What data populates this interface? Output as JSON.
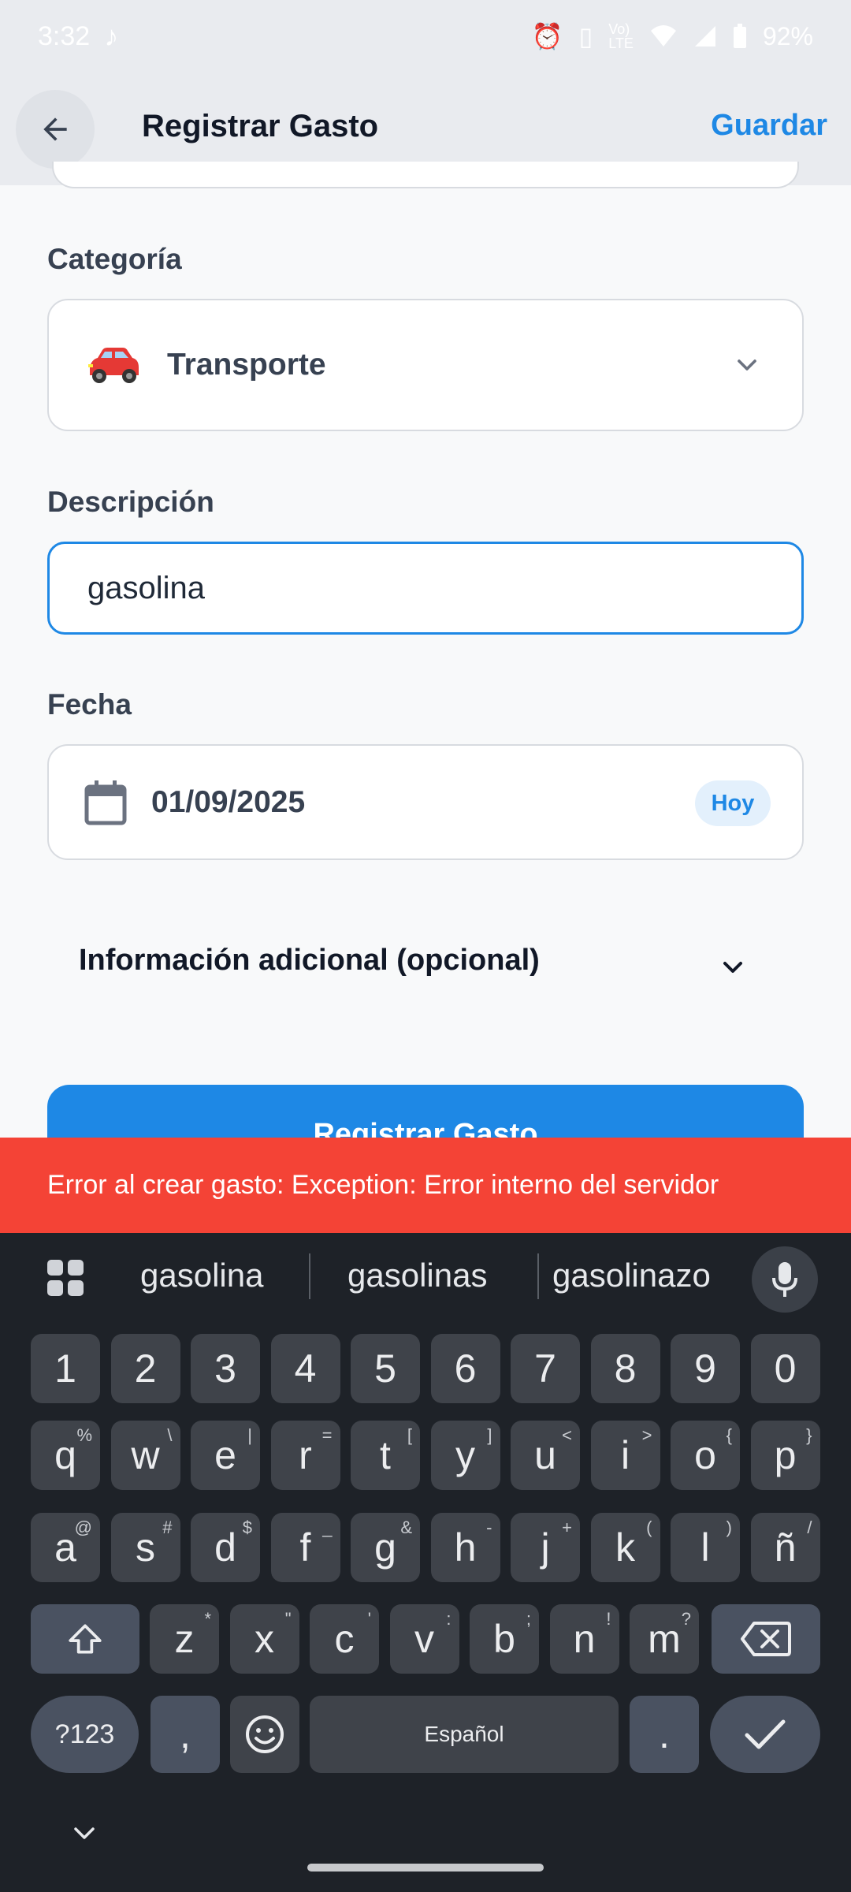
{
  "status_bar": {
    "time": "3:32",
    "battery": "92%"
  },
  "app_bar": {
    "title": "Registrar Gasto",
    "save_label": "Guardar"
  },
  "form": {
    "category": {
      "label": "Categoría",
      "value": "Transporte",
      "icon": "car-icon"
    },
    "description": {
      "label": "Descripción",
      "value": "gasolina"
    },
    "date": {
      "label": "Fecha",
      "value": "01/09/2025",
      "today_label": "Hoy"
    },
    "additional_info_label": "Información adicional (opcional)",
    "submit_label": "Registrar Gasto"
  },
  "snackbar": {
    "message": "Error al crear gasto: Exception: Error interno del servidor"
  },
  "keyboard": {
    "suggestions": [
      "gasolina",
      "gasolinas",
      "gasolinazo"
    ],
    "number_row": [
      "1",
      "2",
      "3",
      "4",
      "5",
      "6",
      "7",
      "8",
      "9",
      "0"
    ],
    "row1": [
      {
        "key": "q",
        "sup": "%"
      },
      {
        "key": "w",
        "sup": "\\"
      },
      {
        "key": "e",
        "sup": "|"
      },
      {
        "key": "r",
        "sup": "="
      },
      {
        "key": "t",
        "sup": "["
      },
      {
        "key": "y",
        "sup": "]"
      },
      {
        "key": "u",
        "sup": "<"
      },
      {
        "key": "i",
        "sup": ">"
      },
      {
        "key": "o",
        "sup": "{"
      },
      {
        "key": "p",
        "sup": "}"
      }
    ],
    "row2": [
      {
        "key": "a",
        "sup": "@"
      },
      {
        "key": "s",
        "sup": "#"
      },
      {
        "key": "d",
        "sup": "$"
      },
      {
        "key": "f",
        "sup": "_"
      },
      {
        "key": "g",
        "sup": "&"
      },
      {
        "key": "h",
        "sup": "-"
      },
      {
        "key": "j",
        "sup": "+"
      },
      {
        "key": "k",
        "sup": "("
      },
      {
        "key": "l",
        "sup": ")"
      },
      {
        "key": "ñ",
        "sup": "/"
      }
    ],
    "row3": [
      {
        "key": "z",
        "sup": "*"
      },
      {
        "key": "x",
        "sup": "\""
      },
      {
        "key": "c",
        "sup": "'"
      },
      {
        "key": "v",
        "sup": ":"
      },
      {
        "key": "b",
        "sup": ";"
      },
      {
        "key": "n",
        "sup": "!"
      },
      {
        "key": "m",
        "sup": "?"
      }
    ],
    "symbols_label": "?123",
    "comma_label": ",",
    "space_label": "Español",
    "period_label": "."
  }
}
